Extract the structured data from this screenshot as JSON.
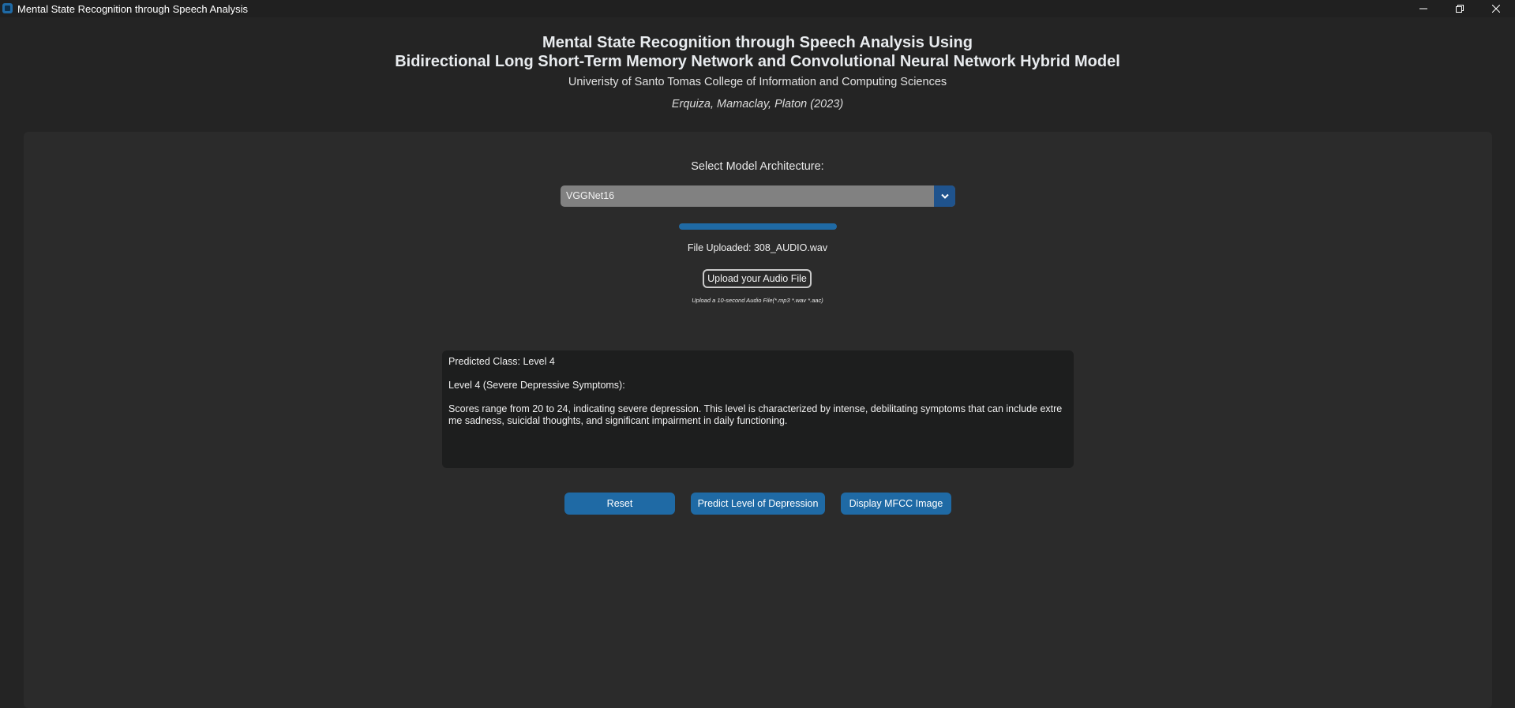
{
  "window": {
    "title": "Mental State Recognition through Speech Analysis",
    "controls": {
      "minimize": "—",
      "maximize": "❐",
      "close": "✕"
    }
  },
  "header": {
    "title_line1": "Mental State Recognition through Speech Analysis Using",
    "title_line2": "Bidirectional Long Short-Term Memory Network and Convolutional Neural Network Hybrid Model",
    "subtitle": "Univeristy of Santo Tomas College of Information and Computing Sciences",
    "authors": "Erquiza, Mamaclay, Platon (2023)"
  },
  "model_select": {
    "label": "Select Model Architecture:",
    "selected": "VGGNet16",
    "arrow_icon": "chevron-down-icon"
  },
  "progress": {
    "value": 1.0
  },
  "upload": {
    "file_label": "File Uploaded: 308_AUDIO.wav",
    "button_label": "Upload your Audio File",
    "hint": "Upload a 10-second Audio File(*.mp3 *.wav *.aac)"
  },
  "result": {
    "text": "Predicted Class: Level 4\n\nLevel 4 (Severe Depressive Symptoms):\n\nScores range from 20 to 24, indicating severe depression. This level is characterized by intense, debilitating symptoms that can include extreme sadness, suicidal thoughts, and significant impairment in daily functioning."
  },
  "buttons": {
    "reset": "Reset",
    "predict": "Predict Level of Depression",
    "mfcc": "Display MFCC Image"
  },
  "colors": {
    "accent": "#1f6aa5",
    "background": "#242424",
    "panel": "#2b2b2b",
    "combo": "#818181",
    "result_bg": "#1d1e1e"
  }
}
